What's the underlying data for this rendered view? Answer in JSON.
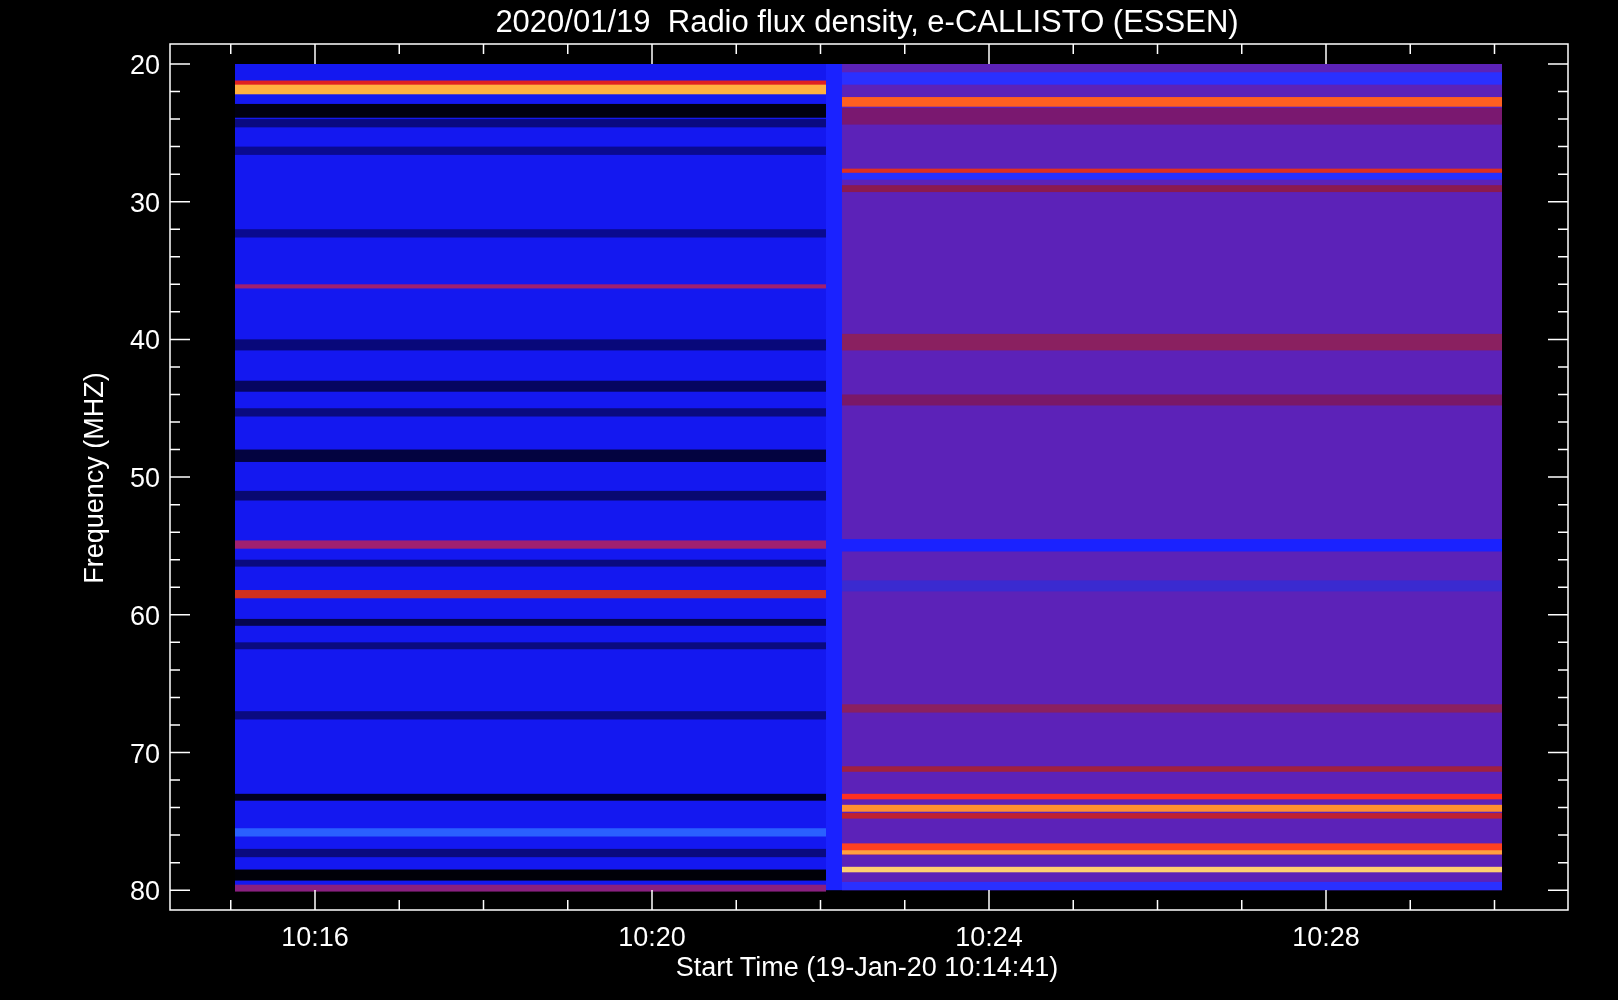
{
  "title": "2020/01/19  Radio flux density, e-CALLISTO (ESSEN)",
  "xlabel": "Start Time (19-Jan-20 10:14:41)",
  "ylabel": "Frequency (MHZ)",
  "y_tick_labels": [
    "20",
    "30",
    "40",
    "50",
    "60",
    "70",
    "80"
  ],
  "x_tick_labels": [
    "10:16",
    "10:20",
    "10:24",
    "10:28"
  ]
}
